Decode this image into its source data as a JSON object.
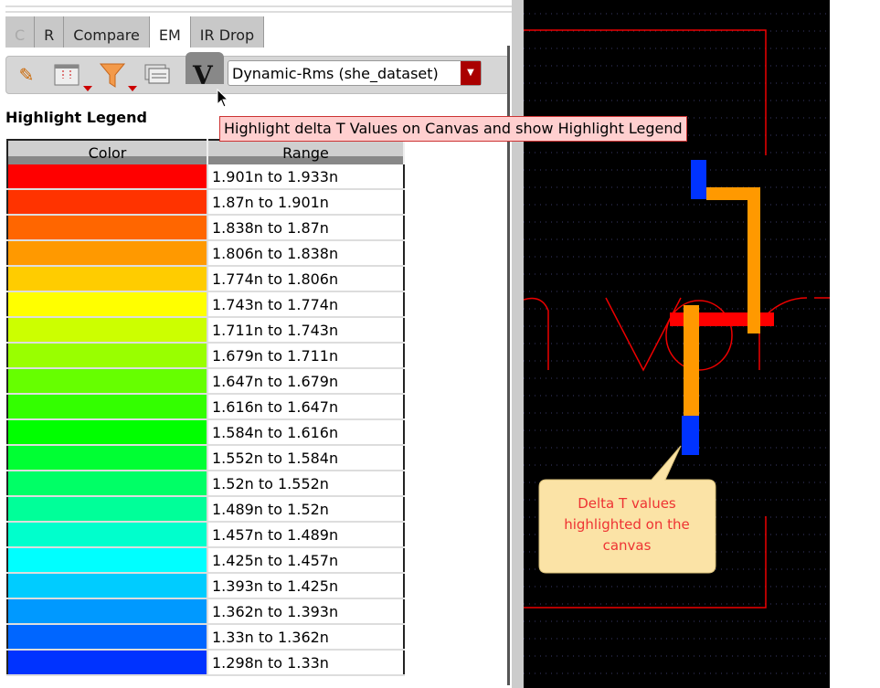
{
  "tabs": [
    {
      "label": "C"
    },
    {
      "label": "R"
    },
    {
      "label": "Compare"
    },
    {
      "label": "EM"
    },
    {
      "label": "IR Drop"
    }
  ],
  "active_tab": "EM",
  "toolbar": {
    "dataset_select": "Dynamic-Rms (she_dataset)",
    "v_button": "V"
  },
  "tooltip": "Highlight delta T Values on Canvas and show Highlight Legend",
  "legend": {
    "title": "Highlight Legend",
    "headers": {
      "color": "Color",
      "range": "Range"
    },
    "rows": [
      {
        "color": "#ff0000",
        "range": "1.901n to 1.933n"
      },
      {
        "color": "#ff3300",
        "range": "1.87n to 1.901n"
      },
      {
        "color": "#ff6600",
        "range": "1.838n to 1.87n"
      },
      {
        "color": "#ff9900",
        "range": "1.806n to 1.838n"
      },
      {
        "color": "#ffcc00",
        "range": "1.774n to 1.806n"
      },
      {
        "color": "#ffff00",
        "range": "1.743n to 1.774n"
      },
      {
        "color": "#ccff00",
        "range": "1.711n to 1.743n"
      },
      {
        "color": "#99ff00",
        "range": "1.679n to 1.711n"
      },
      {
        "color": "#66ff00",
        "range": "1.647n to 1.679n"
      },
      {
        "color": "#33ff00",
        "range": "1.616n to 1.647n"
      },
      {
        "color": "#00ff00",
        "range": "1.584n to 1.616n"
      },
      {
        "color": "#00ff33",
        "range": "1.552n to 1.584n"
      },
      {
        "color": "#00ff66",
        "range": "1.52n to 1.552n"
      },
      {
        "color": "#00ff99",
        "range": "1.489n to 1.52n"
      },
      {
        "color": "#00ffcc",
        "range": "1.457n to 1.489n"
      },
      {
        "color": "#00ffff",
        "range": "1.425n to 1.457n"
      },
      {
        "color": "#00ccff",
        "range": "1.393n to 1.425n"
      },
      {
        "color": "#0099ff",
        "range": "1.362n to 1.393n"
      },
      {
        "color": "#0066ff",
        "range": "1.33n to 1.362n"
      },
      {
        "color": "#0033ff",
        "range": "1.298n to 1.33n"
      }
    ]
  },
  "callout": "Delta T values highlighted on the canvas"
}
